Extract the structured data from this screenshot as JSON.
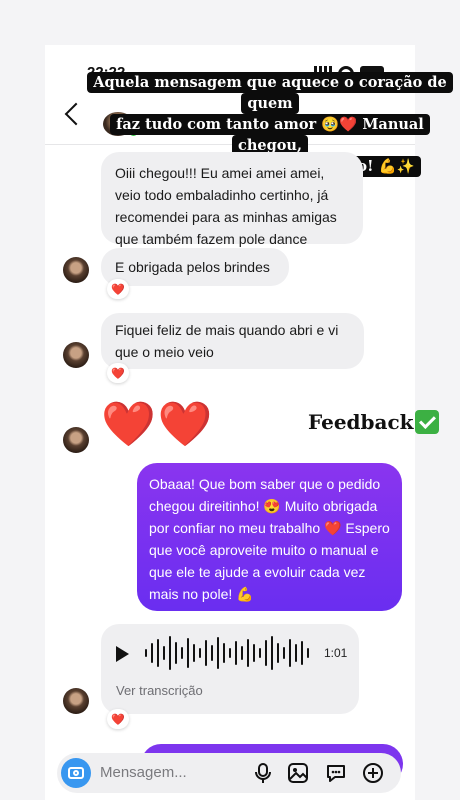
{
  "status_bar": {
    "time": "22:22"
  },
  "banner": {
    "line1": "Aquela mensagem que aquece o coração de quem",
    "line2": "faz tudo com tanto amor 🥹❤️ Manual chegou,",
    "line3": "agora é hora de treinar muito! 💪✨"
  },
  "messages": [
    {
      "side": "in",
      "text": "Oiii chegou!!! Eu amei amei amei, veio todo embaladinho certinho, já recomendei para as minhas amigas que também fazem pole dance"
    },
    {
      "side": "in",
      "text": "E obrigada pelos brindes",
      "reaction": "❤️"
    },
    {
      "side": "in",
      "text": "Fiquei feliz de mais quando abri e vi que o meio veio",
      "reaction": "❤️"
    },
    {
      "side": "in",
      "text": "❤️❤️"
    },
    {
      "side": "out",
      "text": "Obaaa! Que bom saber que o pedido chegou direitinho! 😍 Muito obrigada por confiar no meu trabalho ❤️ Espero que você aproveite muito o manual e que ele te ajude a evoluir cada vez mais no pole! 💪"
    },
    {
      "side": "in",
      "type": "audio",
      "duration": "1:01",
      "transcript_link": "Ver transcrição",
      "reaction": "❤️"
    }
  ],
  "overlay": {
    "feedback_label": "Feedback"
  },
  "composer": {
    "placeholder": "Mensagem..."
  },
  "colors": {
    "outgoing": "#7b2ff2",
    "incoming": "#efeff1",
    "camera": "#3897f0",
    "online": "#2ecc40"
  }
}
